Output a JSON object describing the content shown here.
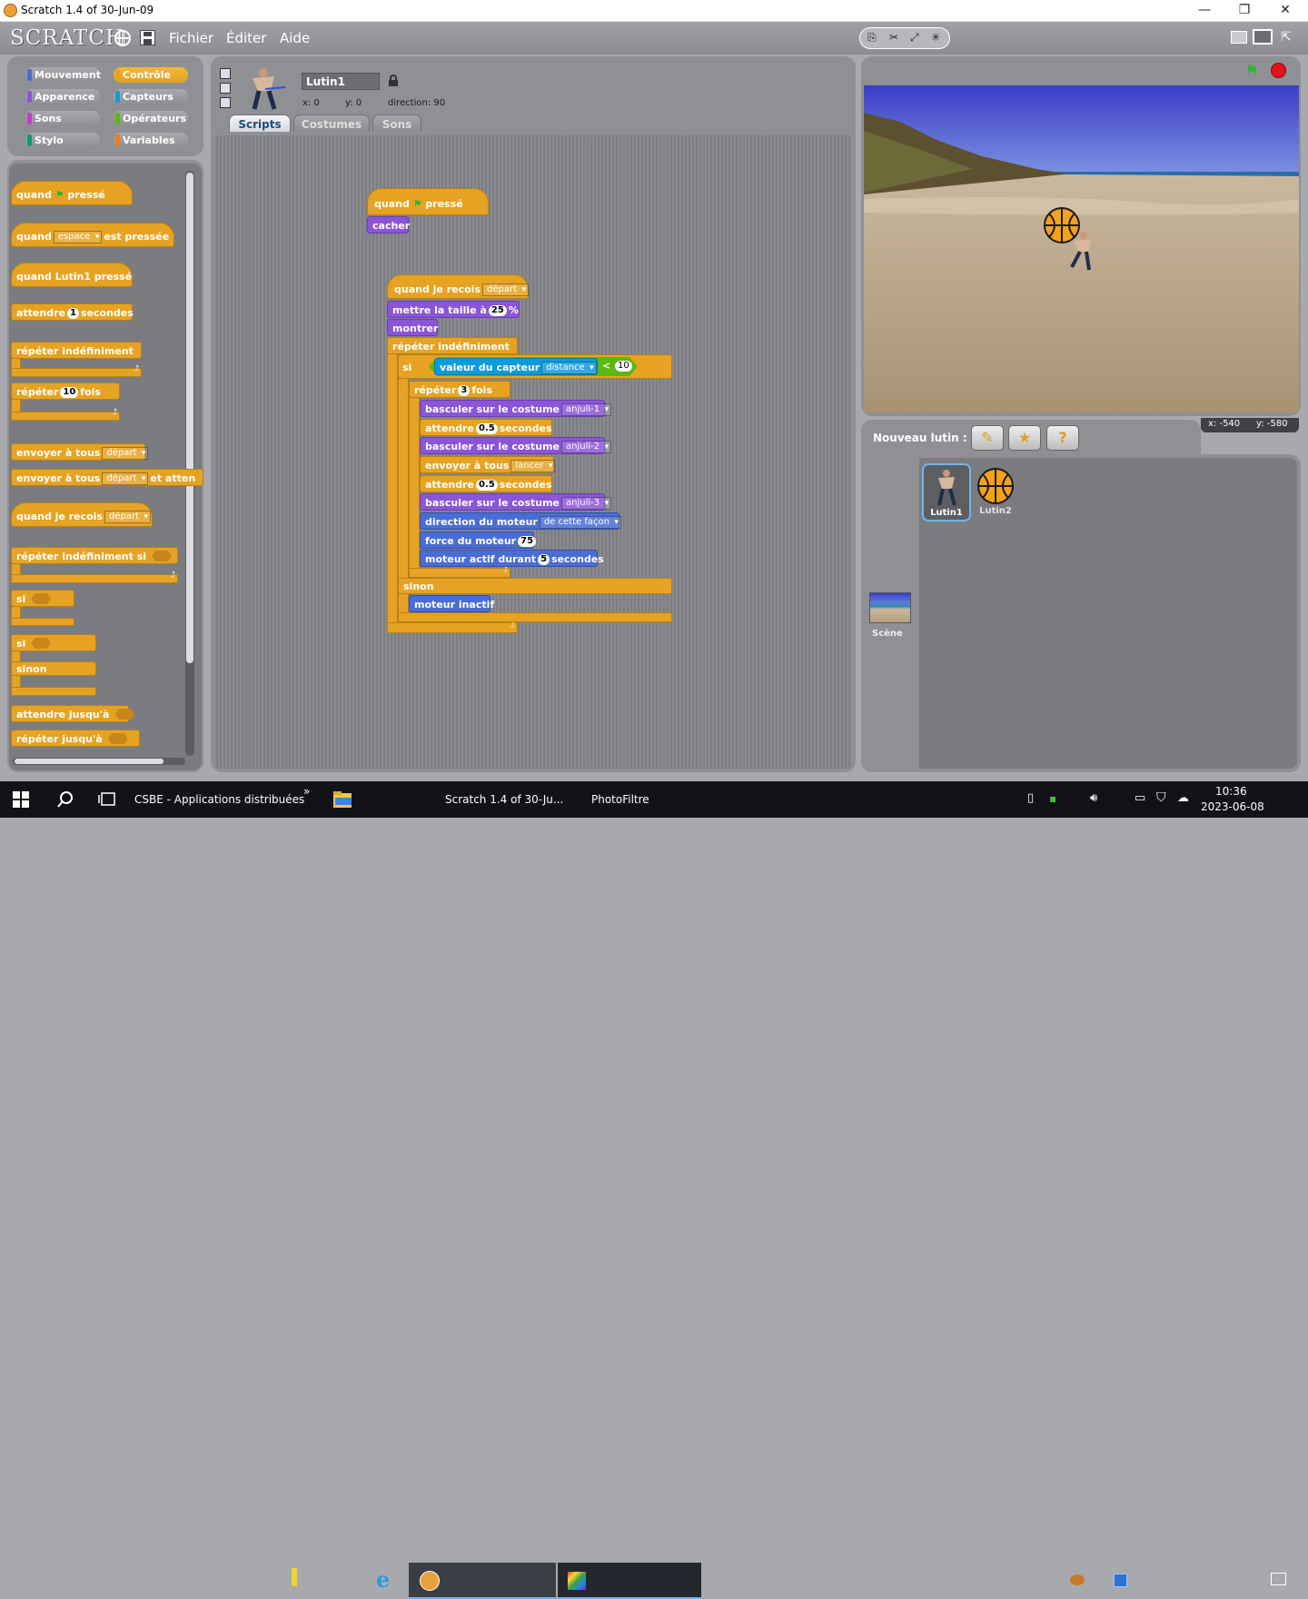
{
  "window": {
    "title": "Scratch 1.4 of 30-Jun-09",
    "controls": [
      "—",
      "❐",
      "✕"
    ]
  },
  "menubar": {
    "logo": "SCRATCH",
    "menus": [
      "Fichier",
      "Éditer",
      "Aide"
    ]
  },
  "categories": [
    {
      "label": "Mouvement",
      "color": "#4a6cd4",
      "selected": false
    },
    {
      "label": "Contrôle",
      "color": "#e6a323",
      "selected": true
    },
    {
      "label": "Apparence",
      "color": "#8a55d7",
      "selected": false
    },
    {
      "label": "Capteurs",
      "color": "#0e9ade",
      "selected": false
    },
    {
      "label": "Sons",
      "color": "#bb42c3",
      "selected": false
    },
    {
      "label": "Opérateurs",
      "color": "#5cb712",
      "selected": false
    },
    {
      "label": "Stylo",
      "color": "#0e9a6c",
      "selected": false
    },
    {
      "label": "Variables",
      "color": "#ee7d16",
      "selected": false
    }
  ],
  "palette": {
    "when_flag": [
      "quand",
      "pressé"
    ],
    "when_key": [
      "quand",
      "espace",
      "est pressée"
    ],
    "when_sprite_clicked": "quand Lutin1 pressé",
    "wait": [
      "attendre",
      "1",
      "secondes"
    ],
    "forever": "répéter indéfiniment",
    "repeat": [
      "répéter",
      "10",
      "fois"
    ],
    "broadcast": [
      "envoyer à tous",
      "départ"
    ],
    "broadcast_wait": [
      "envoyer à tous",
      "départ",
      "et atten"
    ],
    "when_receive": [
      "quand je recois",
      "départ"
    ],
    "forever_if": "répéter indéfiniment si",
    "if": "si",
    "if_else": [
      "si",
      "sinon"
    ],
    "wait_until": "attendre jusqu'à",
    "repeat_until": "répéter jusqu'à"
  },
  "sprite_info": {
    "name": "Lutin1",
    "x_label": "x: 0",
    "y_label": "y: 0",
    "direction_label": "direction: 90"
  },
  "tabs": [
    "Scripts",
    "Costumes",
    "Sons"
  ],
  "scripts": {
    "s1_hat": [
      "quand",
      "pressé"
    ],
    "s1_hide": "cacher",
    "s2_hat": [
      "quand je recois",
      "départ"
    ],
    "set_size": [
      "mettre la taille à",
      "25",
      "%"
    ],
    "show": "montrer",
    "forever": "répéter indéfiniment",
    "if_label": "si",
    "sensor": [
      "valeur du capteur",
      "distance",
      "<",
      "10"
    ],
    "repeat": [
      "répéter",
      "3",
      "fois"
    ],
    "costume1": [
      "basculer sur le costume",
      "anjuli-1"
    ],
    "wait1": [
      "attendre",
      "0.5",
      "secondes"
    ],
    "costume2": [
      "basculer sur le costume",
      "anjuli-2"
    ],
    "broadcast": [
      "envoyer à tous",
      "lancer"
    ],
    "wait2": [
      "attendre",
      "0.5",
      "secondes"
    ],
    "costume3": [
      "basculer sur le costume",
      "anjuli-3"
    ],
    "motor_dir": [
      "direction du moteur",
      "de cette façon"
    ],
    "motor_power": [
      "force du moteur",
      "75"
    ],
    "motor_on": [
      "moteur actif durant",
      "5",
      "secondes"
    ],
    "else_label": "sinon",
    "motor_off": "moteur inactif"
  },
  "stage": {
    "coords": [
      "x: -540",
      "y: -580"
    ]
  },
  "new_sprite": {
    "label": "Nouveau lutin :"
  },
  "sprites": [
    {
      "name": "Lutin1",
      "selected": true
    },
    {
      "name": "Lutin2",
      "selected": false
    }
  ],
  "scene_label": "Scène",
  "taskbar": {
    "items": [
      "CSBE - Applications distribuées",
      "Scratch 1.4 of 30-Ju...",
      "PhotoFiltre"
    ],
    "time": "10:36",
    "date": "2023-06-08",
    "chevron": "»"
  }
}
